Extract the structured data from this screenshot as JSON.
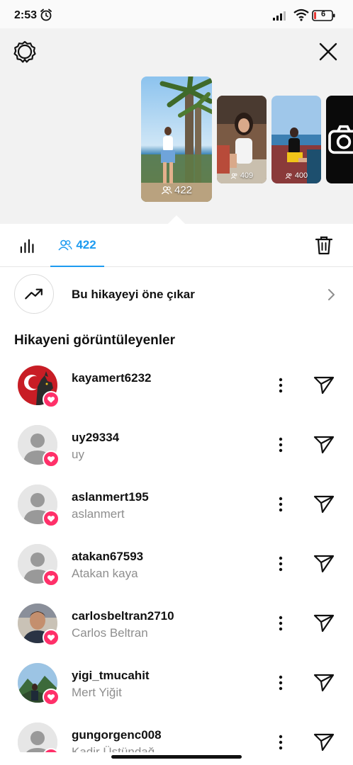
{
  "status_bar": {
    "time": "2:53",
    "battery": "6"
  },
  "header": {
    "main_story_views": "422",
    "thumbnails": [
      {
        "views": "409"
      },
      {
        "views": "400"
      }
    ]
  },
  "tabs": {
    "viewers_count": "422"
  },
  "promote": {
    "label": "Bu hikayeyi öne çıkar"
  },
  "viewers_section": {
    "title": "Hikayeni görüntüleyenler",
    "viewers": [
      {
        "username": "kayamert6232",
        "fullname": "",
        "avatar": "flag-wolf-photo",
        "liked": true
      },
      {
        "username": "uy29334",
        "fullname": "uy",
        "avatar": "default-avatar",
        "liked": true
      },
      {
        "username": "aslanmert195",
        "fullname": "aslanmert",
        "avatar": "default-avatar",
        "liked": true
      },
      {
        "username": "atakan67593",
        "fullname": "Atakan kaya",
        "avatar": "default-avatar",
        "liked": true
      },
      {
        "username": "carlosbeltran2710",
        "fullname": "Carlos Beltran",
        "avatar": "man-photo",
        "liked": true
      },
      {
        "username": "yigi_tmucahit",
        "fullname": "Mert Yiğit",
        "avatar": "mountain-photo",
        "liked": true
      },
      {
        "username": "gungorgenc008",
        "fullname": "Kadir Üstündağ",
        "avatar": "default-avatar",
        "liked": true
      }
    ]
  },
  "colors": {
    "accent": "#1d9bf0",
    "like": "#ff3069",
    "muted_text": "#8e8e8e",
    "header_bg": "#f2f2f2"
  }
}
